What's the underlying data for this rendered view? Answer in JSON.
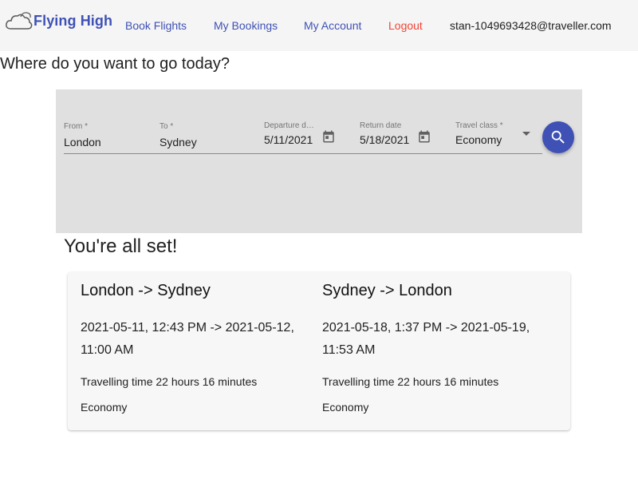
{
  "header": {
    "logo_text": "Flying High",
    "nav": {
      "book_flights": "Book Flights",
      "my_bookings": "My Bookings",
      "my_account": "My Account",
      "logout": "Logout"
    },
    "user_email": "stan-1049693428@traveller.com"
  },
  "page": {
    "heading": "Where do you want to go today?"
  },
  "search": {
    "from": {
      "label": "From *",
      "value": "London"
    },
    "to": {
      "label": "To *",
      "value": "Sydney"
    },
    "departure": {
      "label": "Departure date",
      "value": "5/11/2021"
    },
    "return": {
      "label": "Return date",
      "value": "5/18/2021"
    },
    "travel_class": {
      "label": "Travel class *",
      "value": "Economy"
    },
    "icons": {
      "calendar": "calendar-icon",
      "dropdown": "dropdown-arrow-icon",
      "search": "search-icon"
    }
  },
  "results": {
    "title": "You're all set!",
    "outbound": {
      "route": "London -> Sydney",
      "times": "2021-05-11, 12:43 PM -> 2021-05-12, 11:00 AM",
      "duration": "Travelling time 22 hours 16 minutes",
      "class": "Economy"
    },
    "inbound": {
      "route": "Sydney -> London",
      "times": "2021-05-18, 1:37 PM -> 2021-05-19, 11:53 AM",
      "duration": "Travelling time 22 hours 16 minutes",
      "class": "Economy"
    }
  },
  "colors": {
    "primary": "#3f51b5",
    "logout": "#f44336",
    "navbar_bg": "#f5f5f5",
    "panel_bg": "#e0e0e0",
    "card_bg": "#f7f7f7"
  }
}
